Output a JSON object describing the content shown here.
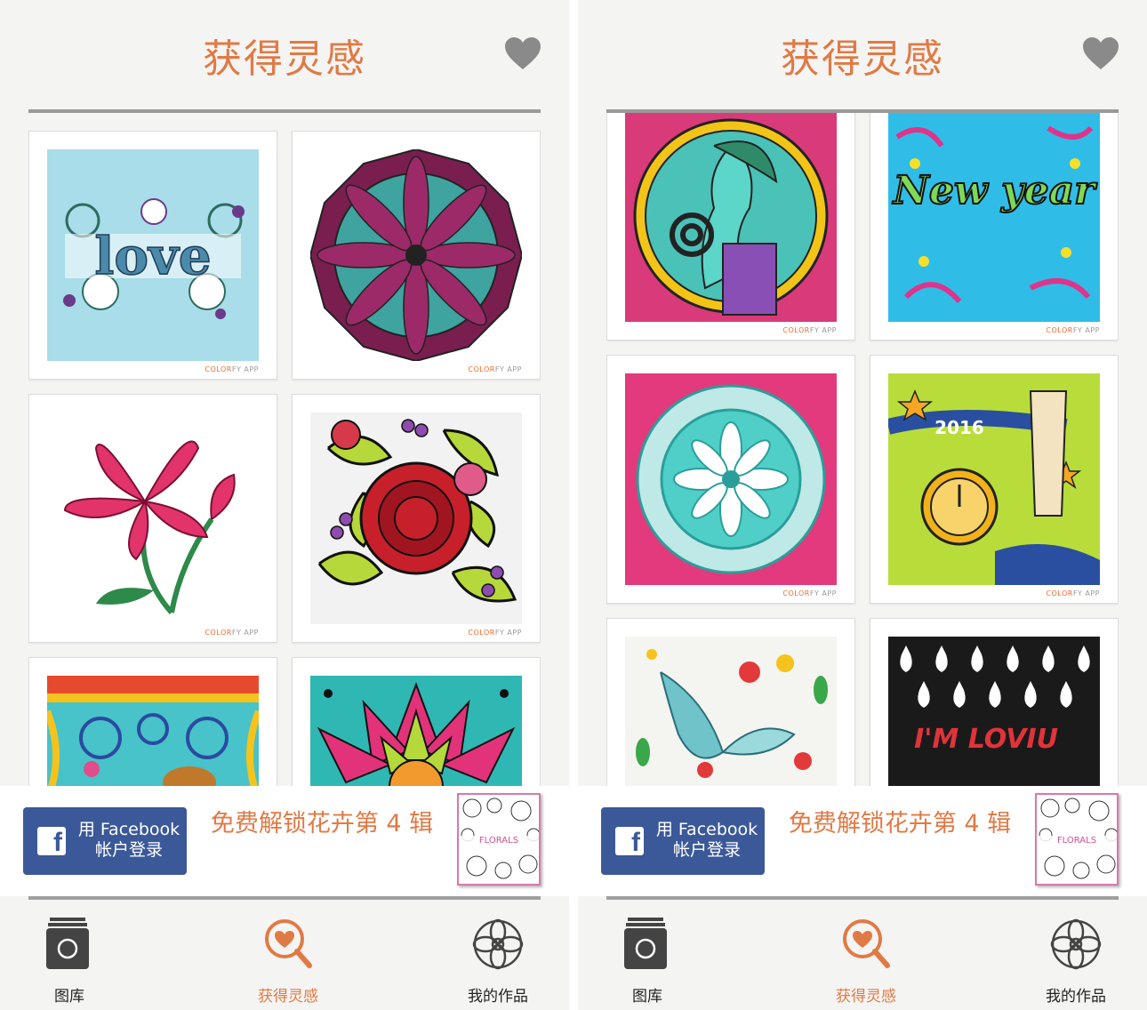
{
  "screens": [
    {
      "header": {
        "title": "获得灵感"
      },
      "banner": {
        "fb_line1": "用 Facebook",
        "fb_line2": "帐户登录",
        "promo": "免费解锁花卉第 4 辑",
        "thumb_label": "FLORALS"
      },
      "tabs": [
        {
          "label": "图库"
        },
        {
          "label": "获得灵感"
        },
        {
          "label": "我的作品"
        }
      ],
      "brand": {
        "a": "COLOR",
        "b": "FY APP"
      }
    },
    {
      "header": {
        "title": "获得灵感"
      },
      "banner": {
        "fb_line1": "用 Facebook",
        "fb_line2": "帐户登录",
        "promo": "免费解锁花卉第 4 辑",
        "thumb_label": "FLORALS"
      },
      "tabs": [
        {
          "label": "图库"
        },
        {
          "label": "获得灵感"
        },
        {
          "label": "我的作品"
        }
      ],
      "brand": {
        "a": "COLOR",
        "b": "FY APP"
      },
      "art_text": {
        "new_year": "New year",
        "year_2016": "2016",
        "im_loviu": "I'M LOVIU"
      }
    }
  ],
  "artworks_left": [
    {
      "name": "love",
      "text": "love"
    },
    {
      "name": "mandala-pink-teal"
    },
    {
      "name": "lily"
    },
    {
      "name": "rose"
    },
    {
      "name": "deer-pattern"
    },
    {
      "name": "lotus-mandala"
    }
  ],
  "colors": {
    "accent": "#e07a45",
    "facebook": "#3b5998",
    "heart": "#8a8a8a"
  }
}
